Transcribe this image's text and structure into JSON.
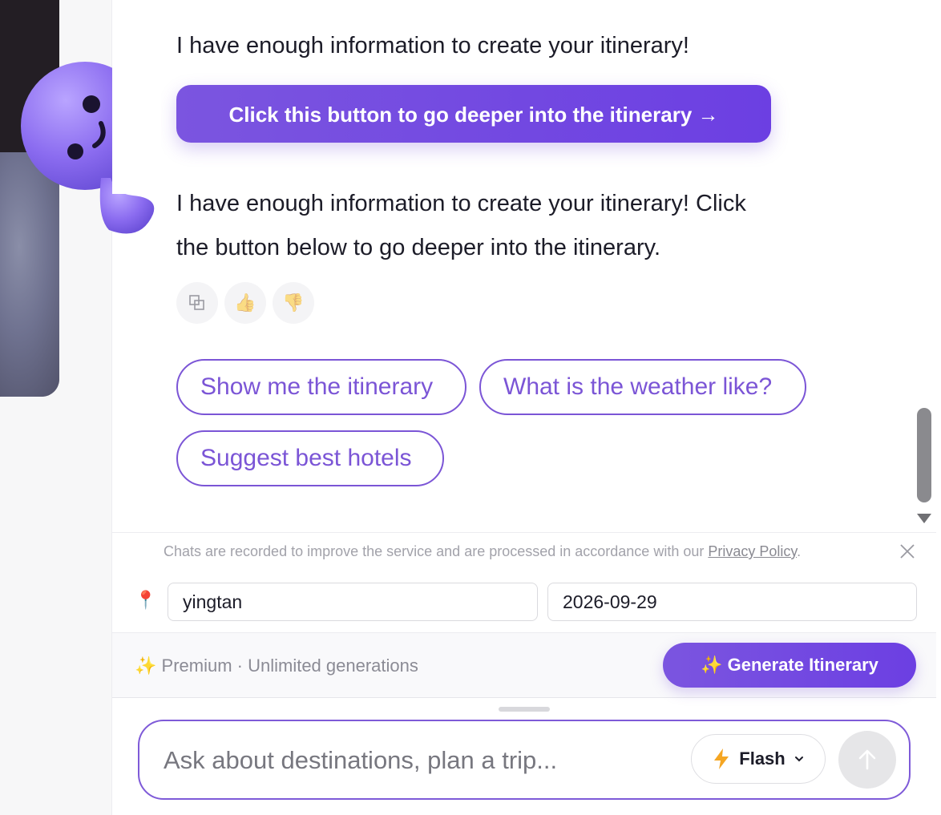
{
  "messages": {
    "intro": "I have enough information to create your itinerary!",
    "cta_label": "Click this button to go deeper into the itinerary →",
    "detail_line1": "I have enough information to create your itinerary! Click",
    "detail_line2": "the button below to go deeper into the itinerary."
  },
  "suggestions": [
    "Show me the itinerary",
    "What is the weather like?",
    "Suggest best hotels"
  ],
  "notice": {
    "text": "Chats are recorded to improve the service and are processed in accordance with our ",
    "link": "Privacy Policy",
    "end": "."
  },
  "trip": {
    "destination": "yingtan",
    "date": "2026-09-29"
  },
  "premium": {
    "label": "Premium · Unlimited generations",
    "generate_label": "Generate Itinerary"
  },
  "composer": {
    "placeholder": "Ask about destinations, plan a trip...",
    "model": "Flash"
  },
  "colors": {
    "accent": "#7b55e0",
    "chip_border": "#7b55d6"
  }
}
